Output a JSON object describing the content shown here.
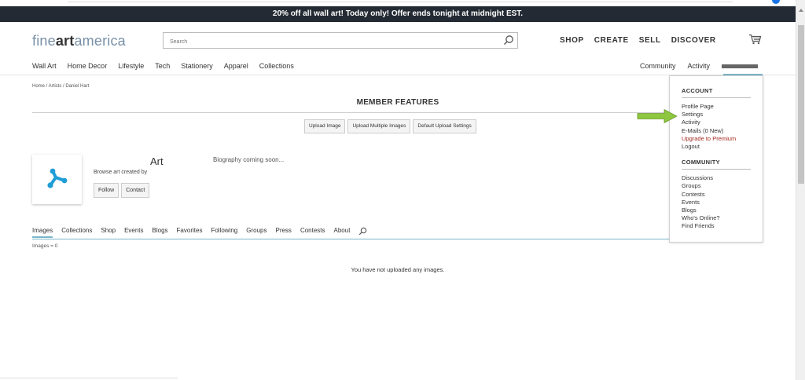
{
  "promo": {
    "text": "20% off all wall art!  Today only!  Offer ends tonight at midnight EST."
  },
  "logo": {
    "part1": "fine",
    "part2": "art",
    "part3": "america"
  },
  "search": {
    "placeholder": "Search"
  },
  "main_nav": [
    "SHOP",
    "CREATE",
    "SELL",
    "DISCOVER"
  ],
  "sub_nav": [
    "Wall Art",
    "Home Decor",
    "Lifestyle",
    "Tech",
    "Stationery",
    "Apparel",
    "Collections"
  ],
  "right_nav": [
    "Community",
    "Activity"
  ],
  "breadcrumb": "Home / Artists / Daniel Hart",
  "member_features": {
    "title": "MEMBER FEATURES",
    "buttons": [
      "Upload Image",
      "Upload Multiple Images",
      "Default Upload Settings"
    ]
  },
  "profile": {
    "name": "Art",
    "browse_text": "Browse art created by",
    "follow_label": "Follow",
    "contact_label": "Contact",
    "bio": "Biography coming soon..."
  },
  "tabs": [
    "Images",
    "Collections",
    "Shop",
    "Events",
    "Blogs",
    "Favorites",
    "Following",
    "Groups",
    "Press",
    "Contests",
    "About"
  ],
  "images_count": "Images = 0",
  "empty_message": "You have not uploaded any images.",
  "account_menu": {
    "account_heading": "ACCOUNT",
    "account_items": [
      "Profile Page",
      "Settings",
      "Activity",
      "E-Mails (0 New)",
      "Upgrade to Premium",
      "Logout"
    ],
    "community_heading": "COMMUNITY",
    "community_items": [
      "Discussions",
      "Groups",
      "Contests",
      "Events",
      "Blogs",
      "Who's Online?",
      "Find Friends"
    ]
  },
  "colors": {
    "promo_bg": "#232a33",
    "accent_teal": "#7ab6c8",
    "premium_red": "#a3271b",
    "arrow_green": "#8dc63f",
    "logo_blue": "#7890a7"
  }
}
